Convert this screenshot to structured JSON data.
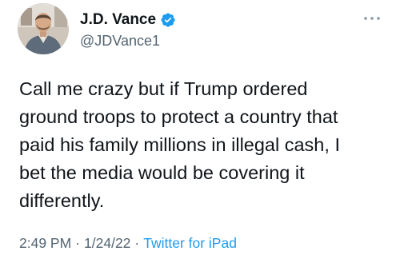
{
  "tweet": {
    "author": {
      "display_name": "J.D. Vance",
      "handle": "@JDVance1",
      "verified": true,
      "avatar_icon": "profile-photo"
    },
    "more_icon": "more-options-icon",
    "text": "Call me crazy but if Trump ordered\nground troops to protect a country that\npaid his family millions in illegal cash, I\nbet the media would be covering it\ndifferently.",
    "time": "2:49 PM",
    "separator": "·",
    "date": "1/24/22",
    "source": "Twitter for iPad"
  },
  "colors": {
    "text": "#0f1419",
    "secondary": "#536471",
    "accent": "#1d9bf0"
  }
}
